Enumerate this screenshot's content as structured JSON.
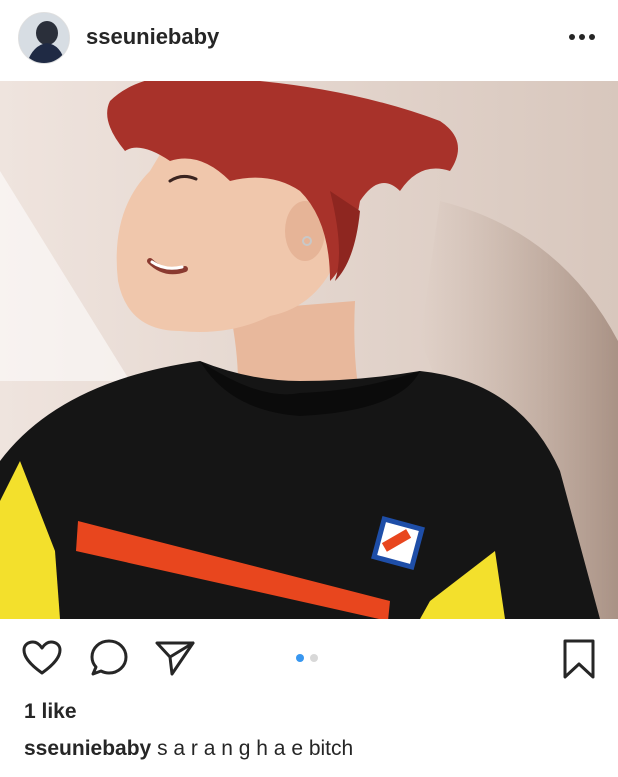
{
  "post": {
    "username": "sseuniebaby",
    "like_count_text": "1 like",
    "caption_username": "sseuniebaby",
    "caption_text": "s a r a n g h a e bitch"
  },
  "icons": {
    "more": "more-horizontal-icon",
    "like": "heart-icon",
    "comment": "comment-bubble-icon",
    "share": "paper-plane-icon",
    "save": "bookmark-icon"
  },
  "carousel": {
    "current": 1,
    "total": 2
  },
  "colors": {
    "active_dot": "#3897f0",
    "inactive_dot": "#d8d8d8",
    "text": "#262626"
  }
}
